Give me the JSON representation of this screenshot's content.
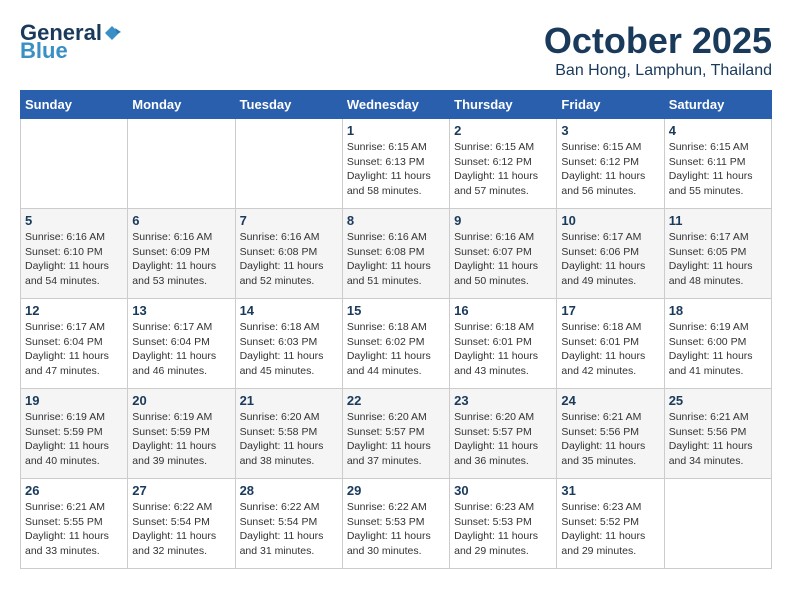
{
  "header": {
    "logo_general": "General",
    "logo_blue": "Blue",
    "month": "October 2025",
    "location": "Ban Hong, Lamphun, Thailand"
  },
  "weekdays": [
    "Sunday",
    "Monday",
    "Tuesday",
    "Wednesday",
    "Thursday",
    "Friday",
    "Saturday"
  ],
  "weeks": [
    [
      {
        "day": "",
        "sunrise": "",
        "sunset": "",
        "daylight": ""
      },
      {
        "day": "",
        "sunrise": "",
        "sunset": "",
        "daylight": ""
      },
      {
        "day": "",
        "sunrise": "",
        "sunset": "",
        "daylight": ""
      },
      {
        "day": "1",
        "sunrise": "Sunrise: 6:15 AM",
        "sunset": "Sunset: 6:13 PM",
        "daylight": "Daylight: 11 hours and 58 minutes."
      },
      {
        "day": "2",
        "sunrise": "Sunrise: 6:15 AM",
        "sunset": "Sunset: 6:12 PM",
        "daylight": "Daylight: 11 hours and 57 minutes."
      },
      {
        "day": "3",
        "sunrise": "Sunrise: 6:15 AM",
        "sunset": "Sunset: 6:12 PM",
        "daylight": "Daylight: 11 hours and 56 minutes."
      },
      {
        "day": "4",
        "sunrise": "Sunrise: 6:15 AM",
        "sunset": "Sunset: 6:11 PM",
        "daylight": "Daylight: 11 hours and 55 minutes."
      }
    ],
    [
      {
        "day": "5",
        "sunrise": "Sunrise: 6:16 AM",
        "sunset": "Sunset: 6:10 PM",
        "daylight": "Daylight: 11 hours and 54 minutes."
      },
      {
        "day": "6",
        "sunrise": "Sunrise: 6:16 AM",
        "sunset": "Sunset: 6:09 PM",
        "daylight": "Daylight: 11 hours and 53 minutes."
      },
      {
        "day": "7",
        "sunrise": "Sunrise: 6:16 AM",
        "sunset": "Sunset: 6:08 PM",
        "daylight": "Daylight: 11 hours and 52 minutes."
      },
      {
        "day": "8",
        "sunrise": "Sunrise: 6:16 AM",
        "sunset": "Sunset: 6:08 PM",
        "daylight": "Daylight: 11 hours and 51 minutes."
      },
      {
        "day": "9",
        "sunrise": "Sunrise: 6:16 AM",
        "sunset": "Sunset: 6:07 PM",
        "daylight": "Daylight: 11 hours and 50 minutes."
      },
      {
        "day": "10",
        "sunrise": "Sunrise: 6:17 AM",
        "sunset": "Sunset: 6:06 PM",
        "daylight": "Daylight: 11 hours and 49 minutes."
      },
      {
        "day": "11",
        "sunrise": "Sunrise: 6:17 AM",
        "sunset": "Sunset: 6:05 PM",
        "daylight": "Daylight: 11 hours and 48 minutes."
      }
    ],
    [
      {
        "day": "12",
        "sunrise": "Sunrise: 6:17 AM",
        "sunset": "Sunset: 6:04 PM",
        "daylight": "Daylight: 11 hours and 47 minutes."
      },
      {
        "day": "13",
        "sunrise": "Sunrise: 6:17 AM",
        "sunset": "Sunset: 6:04 PM",
        "daylight": "Daylight: 11 hours and 46 minutes."
      },
      {
        "day": "14",
        "sunrise": "Sunrise: 6:18 AM",
        "sunset": "Sunset: 6:03 PM",
        "daylight": "Daylight: 11 hours and 45 minutes."
      },
      {
        "day": "15",
        "sunrise": "Sunrise: 6:18 AM",
        "sunset": "Sunset: 6:02 PM",
        "daylight": "Daylight: 11 hours and 44 minutes."
      },
      {
        "day": "16",
        "sunrise": "Sunrise: 6:18 AM",
        "sunset": "Sunset: 6:01 PM",
        "daylight": "Daylight: 11 hours and 43 minutes."
      },
      {
        "day": "17",
        "sunrise": "Sunrise: 6:18 AM",
        "sunset": "Sunset: 6:01 PM",
        "daylight": "Daylight: 11 hours and 42 minutes."
      },
      {
        "day": "18",
        "sunrise": "Sunrise: 6:19 AM",
        "sunset": "Sunset: 6:00 PM",
        "daylight": "Daylight: 11 hours and 41 minutes."
      }
    ],
    [
      {
        "day": "19",
        "sunrise": "Sunrise: 6:19 AM",
        "sunset": "Sunset: 5:59 PM",
        "daylight": "Daylight: 11 hours and 40 minutes."
      },
      {
        "day": "20",
        "sunrise": "Sunrise: 6:19 AM",
        "sunset": "Sunset: 5:59 PM",
        "daylight": "Daylight: 11 hours and 39 minutes."
      },
      {
        "day": "21",
        "sunrise": "Sunrise: 6:20 AM",
        "sunset": "Sunset: 5:58 PM",
        "daylight": "Daylight: 11 hours and 38 minutes."
      },
      {
        "day": "22",
        "sunrise": "Sunrise: 6:20 AM",
        "sunset": "Sunset: 5:57 PM",
        "daylight": "Daylight: 11 hours and 37 minutes."
      },
      {
        "day": "23",
        "sunrise": "Sunrise: 6:20 AM",
        "sunset": "Sunset: 5:57 PM",
        "daylight": "Daylight: 11 hours and 36 minutes."
      },
      {
        "day": "24",
        "sunrise": "Sunrise: 6:21 AM",
        "sunset": "Sunset: 5:56 PM",
        "daylight": "Daylight: 11 hours and 35 minutes."
      },
      {
        "day": "25",
        "sunrise": "Sunrise: 6:21 AM",
        "sunset": "Sunset: 5:56 PM",
        "daylight": "Daylight: 11 hours and 34 minutes."
      }
    ],
    [
      {
        "day": "26",
        "sunrise": "Sunrise: 6:21 AM",
        "sunset": "Sunset: 5:55 PM",
        "daylight": "Daylight: 11 hours and 33 minutes."
      },
      {
        "day": "27",
        "sunrise": "Sunrise: 6:22 AM",
        "sunset": "Sunset: 5:54 PM",
        "daylight": "Daylight: 11 hours and 32 minutes."
      },
      {
        "day": "28",
        "sunrise": "Sunrise: 6:22 AM",
        "sunset": "Sunset: 5:54 PM",
        "daylight": "Daylight: 11 hours and 31 minutes."
      },
      {
        "day": "29",
        "sunrise": "Sunrise: 6:22 AM",
        "sunset": "Sunset: 5:53 PM",
        "daylight": "Daylight: 11 hours and 30 minutes."
      },
      {
        "day": "30",
        "sunrise": "Sunrise: 6:23 AM",
        "sunset": "Sunset: 5:53 PM",
        "daylight": "Daylight: 11 hours and 29 minutes."
      },
      {
        "day": "31",
        "sunrise": "Sunrise: 6:23 AM",
        "sunset": "Sunset: 5:52 PM",
        "daylight": "Daylight: 11 hours and 29 minutes."
      },
      {
        "day": "",
        "sunrise": "",
        "sunset": "",
        "daylight": ""
      }
    ]
  ]
}
